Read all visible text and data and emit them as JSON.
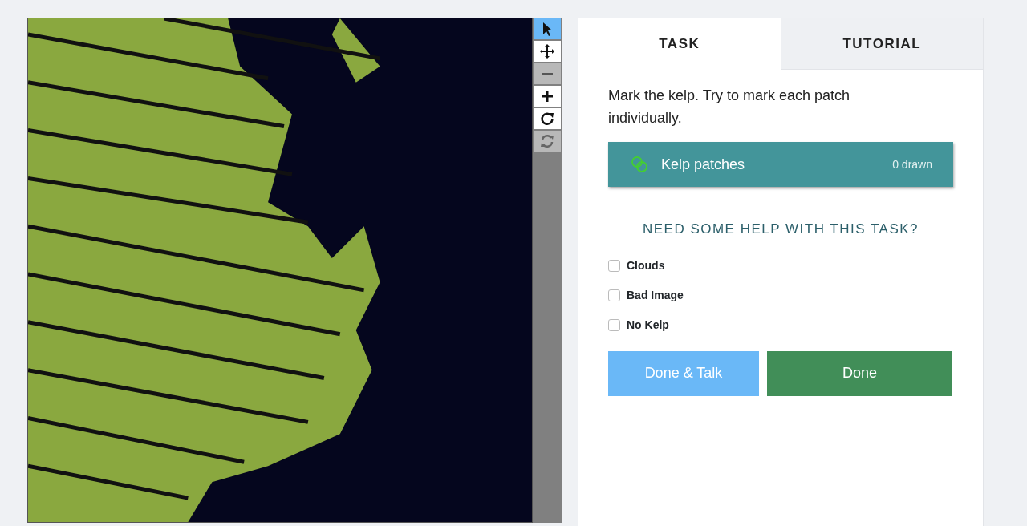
{
  "tools": [
    {
      "kind": "pointer",
      "selected": true,
      "disabled": false
    },
    {
      "kind": "move",
      "selected": false,
      "disabled": false
    },
    {
      "kind": "zoom-out",
      "selected": false,
      "disabled": true
    },
    {
      "kind": "zoom-in",
      "selected": false,
      "disabled": false
    },
    {
      "kind": "rotate",
      "selected": false,
      "disabled": false
    },
    {
      "kind": "reset",
      "selected": false,
      "disabled": true
    }
  ],
  "tabs": [
    {
      "label": "TASK",
      "selected": true
    },
    {
      "label": "TUTORIAL",
      "selected": false
    }
  ],
  "instruction": "Mark the kelp. Try to mark each patch individually.",
  "task_tool": {
    "label": "Kelp patches",
    "count": "0 drawn",
    "color": "#44ce32"
  },
  "help_heading": "NEED SOME HELP WITH THIS TASK?",
  "options": [
    {
      "label": "Clouds",
      "checked": false
    },
    {
      "label": "Bad Image",
      "checked": false
    },
    {
      "label": "No Kelp",
      "checked": false
    }
  ],
  "buttons": [
    {
      "kind": "talk",
      "label": "Done & Talk"
    },
    {
      "kind": "done",
      "label": "Done"
    }
  ]
}
